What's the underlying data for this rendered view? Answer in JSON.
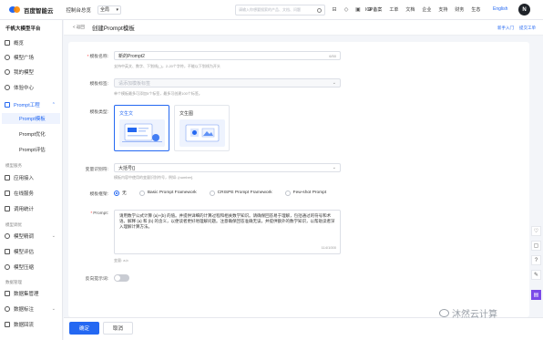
{
  "topbar": {
    "brand": "百度智能云",
    "console": "控制台总览",
    "region": "全局",
    "search_placeholder": "请输入你想要搜索的产品、文档、问题",
    "links": [
      "ICP备案",
      "工单",
      "文档",
      "企业",
      "支持",
      "财务",
      "生态"
    ],
    "language": "English",
    "avatar_letter": "N"
  },
  "sidebar": {
    "title": "千帆大模型平台",
    "items": [
      {
        "label": "概览"
      },
      {
        "label": "模型广场"
      },
      {
        "label": "我的模型"
      },
      {
        "label": "体验中心"
      }
    ],
    "prompt_group": {
      "label": "Prompt工程",
      "children": [
        "Prompt模板",
        "Prompt优化",
        "Prompt评估"
      ]
    },
    "section_app": "模型服务",
    "app_items": [
      "应用接入",
      "在线服务",
      "调用统计"
    ],
    "section_tune": "模型调优",
    "tune_items": [
      "模型精调",
      "模型评估",
      "模型压缩"
    ],
    "section_data": "数据管理",
    "data_items": [
      "数据集管理",
      "数据标注",
      "数据回流"
    ]
  },
  "breadcrumb": {
    "back": "< 返回",
    "title": "创建Prompt模板",
    "help": [
      "新手入门",
      "提交工单"
    ]
  },
  "form": {
    "name_label": "模板名称:",
    "name_value": "新的Prompt2",
    "name_counter": "6/50",
    "name_hint": "支持中英文、数字、下划线(_)，2-20个字符，不能以下划线为开头",
    "tag_label": "模板标签:",
    "tag_placeholder": "请添加模板标签",
    "tag_hint": "单个模板最多可添加5个标签，最多可创建100个标签。",
    "type_label": "模板类型:",
    "type_options": [
      {
        "title": "文生文",
        "selected": true
      },
      {
        "title": "文生图",
        "selected": false
      }
    ],
    "var_label": "变量识别符:",
    "var_value": "大括号{}",
    "var_hint": "模板内容中使用的变量识别符号，例如: {number}",
    "frame_label": "模板框架:",
    "frame_options": [
      {
        "label": "无",
        "selected": true
      },
      {
        "label": "Basic Prompt Framework",
        "selected": false
      },
      {
        "label": "CRISPE Prompt Framework",
        "selected": false
      },
      {
        "label": "Few-shot Prompt",
        "selected": false
      }
    ],
    "prompt_label": "Prompt:",
    "prompt_text": "请用数学公式计算 {a}+{b} 的值。并提供详细的计算过程和相关数学知识。请确保回答易于理解，包括通过的符号和术语。解释 {a} 和 {b} 的含义，以便读者更好地理解问题。注意确保回答准确无误，并提供额外的数学知识，以帮助读者深入理解计算方法。",
    "prompt_counter": "114/1000",
    "var_count": "变量: a,b",
    "negative_label": "反向提示词:"
  },
  "footer": {
    "confirm": "确定",
    "cancel": "取消"
  },
  "watermark": "沐然云计算",
  "colors": {
    "accent": "#2468f2",
    "purple": "#7b4ae8"
  }
}
